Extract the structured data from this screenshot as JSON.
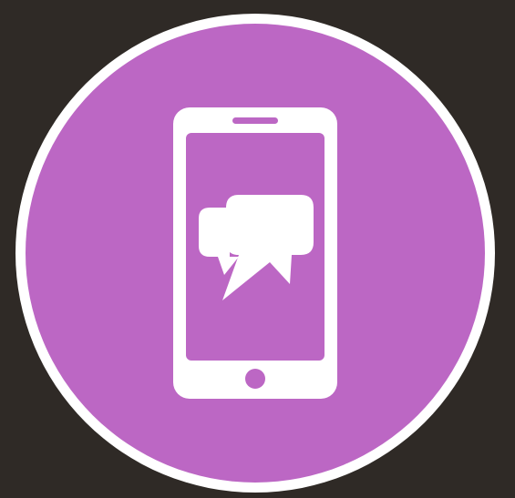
{
  "icon": {
    "name": "mobile-chat-icon",
    "elements": [
      "smartphone-icon",
      "chat-bubbles-icon"
    ]
  },
  "colors": {
    "background": "#2f2a26",
    "circle_fill": "#bc67c4",
    "circle_ring": "#ffffff",
    "screen_fill": "#bc67c4",
    "phone_body": "#ffffff"
  }
}
